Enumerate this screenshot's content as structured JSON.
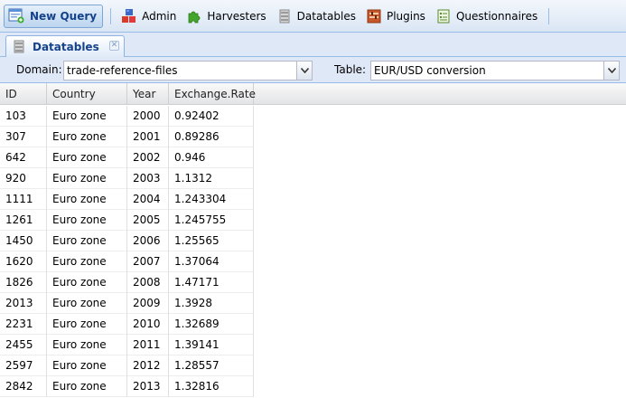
{
  "toolbar": {
    "new_query": "New Query",
    "items": [
      {
        "label": "Admin",
        "icon": "blocks-icon"
      },
      {
        "label": "Harvesters",
        "icon": "puzzle-icon"
      },
      {
        "label": "Datatables",
        "icon": "database-icon"
      },
      {
        "label": "Plugins",
        "icon": "plugins-icon"
      },
      {
        "label": "Questionnaires",
        "icon": "questionnaire-icon"
      }
    ]
  },
  "tab": {
    "label": "Datatables",
    "icon": "database-icon"
  },
  "filters": {
    "domain_label": "Domain:",
    "domain_value": "trade-reference-files",
    "table_label": "Table:",
    "table_value": "EUR/USD conversion"
  },
  "grid": {
    "columns": [
      "ID",
      "Country",
      "Year",
      "Exchange.Rate"
    ],
    "rows": [
      [
        "103",
        "Euro zone",
        "2000",
        "0.92402"
      ],
      [
        "307",
        "Euro zone",
        "2001",
        "0.89286"
      ],
      [
        "642",
        "Euro zone",
        "2002",
        "0.946"
      ],
      [
        "920",
        "Euro zone",
        "2003",
        "1.1312"
      ],
      [
        "1111",
        "Euro zone",
        "2004",
        "1.243304"
      ],
      [
        "1261",
        "Euro zone",
        "2005",
        "1.245755"
      ],
      [
        "1450",
        "Euro zone",
        "2006",
        "1.25565"
      ],
      [
        "1620",
        "Euro zone",
        "2007",
        "1.37064"
      ],
      [
        "1826",
        "Euro zone",
        "2008",
        "1.47171"
      ],
      [
        "2013",
        "Euro zone",
        "2009",
        "1.3928"
      ],
      [
        "2231",
        "Euro zone",
        "2010",
        "1.32689"
      ],
      [
        "2455",
        "Euro zone",
        "2011",
        "1.39141"
      ],
      [
        "2597",
        "Euro zone",
        "2012",
        "1.28557"
      ],
      [
        "2842",
        "Euro zone",
        "2013",
        "1.32816"
      ]
    ]
  },
  "colors": {
    "accent": "#15428b",
    "panel": "#dfe8f6",
    "border": "#99bbe8"
  }
}
